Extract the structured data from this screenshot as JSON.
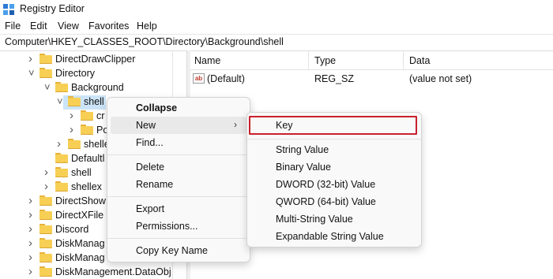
{
  "window": {
    "title": "Registry Editor",
    "icon": "registry-editor-icon"
  },
  "menu": [
    "File",
    "Edit",
    "View",
    "Favorites",
    "Help"
  ],
  "address": "Computer\\HKEY_CLASSES_ROOT\\Directory\\Background\\shell",
  "tree": [
    {
      "label": "DirectDrawClipper",
      "chevron": ">"
    },
    {
      "label": "Directory",
      "chevron": "v"
    },
    {
      "label": "Background",
      "chevron": "v"
    },
    {
      "label": "shell",
      "chevron": "v",
      "selected": true
    },
    {
      "label": "cr",
      "chevron": ">"
    },
    {
      "label": "Po",
      "chevron": ">"
    },
    {
      "label": "shelle",
      "chevron": ">"
    },
    {
      "label": "Defaultl",
      "chevron": ""
    },
    {
      "label": "shell",
      "chevron": ">"
    },
    {
      "label": "shellex",
      "chevron": ">"
    },
    {
      "label": "DirectShow",
      "chevron": ">"
    },
    {
      "label": "DirectXFile",
      "chevron": ">"
    },
    {
      "label": "Discord",
      "chevron": ">"
    },
    {
      "label": "DiskManag",
      "chevron": ">"
    },
    {
      "label": "DiskManag",
      "chevron": ">"
    },
    {
      "label": "DiskManagement.DataObj",
      "chevron": ">"
    }
  ],
  "columns": {
    "name": "Name",
    "type": "Type",
    "data": "Data"
  },
  "values": [
    {
      "name": "(Default)",
      "type": "REG_SZ",
      "data": "(value not set)",
      "icon": "ab"
    }
  ],
  "context_menu": {
    "collapse": "Collapse",
    "new": "New",
    "new_arrow": ">",
    "find": "Find...",
    "delete": "Delete",
    "rename": "Rename",
    "export": "Export",
    "permissions": "Permissions...",
    "copy_key_name": "Copy Key Name"
  },
  "new_submenu": {
    "key": "Key",
    "string": "String Value",
    "binary": "Binary Value",
    "dword": "DWORD (32-bit) Value",
    "qword": "QWORD (64-bit) Value",
    "multi": "Multi-String Value",
    "expandable": "Expandable String Value"
  },
  "colors": {
    "highlight": "#c8202e",
    "selection": "#cce4f7",
    "folder": "#f7cf55"
  }
}
